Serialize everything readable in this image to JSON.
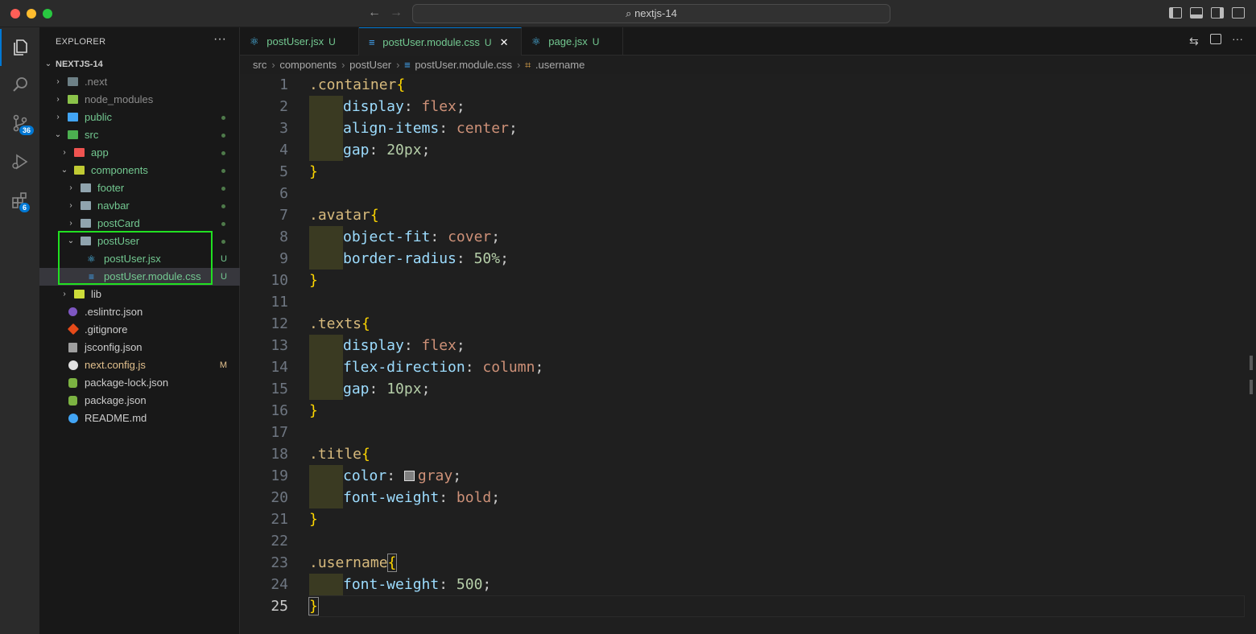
{
  "window": {
    "command_center": "nextjs-14"
  },
  "activity_bar": {
    "source_control_badge": "36",
    "extensions_badge": "6"
  },
  "sidebar": {
    "title": "EXPLORER",
    "more": "···",
    "root": "NEXTJS-14",
    "items": [
      {
        "label": ".next",
        "status": ""
      },
      {
        "label": "node_modules",
        "status": ""
      },
      {
        "label": "public",
        "status": "•"
      },
      {
        "label": "src",
        "status": "•"
      },
      {
        "label": "app",
        "status": "•"
      },
      {
        "label": "components",
        "status": "•"
      },
      {
        "label": "footer",
        "status": "•"
      },
      {
        "label": "navbar",
        "status": "•"
      },
      {
        "label": "postCard",
        "status": "•"
      },
      {
        "label": "postUser",
        "status": "•"
      },
      {
        "label": "postUser.jsx",
        "status": "U"
      },
      {
        "label": "postUser.module.css",
        "status": "U"
      },
      {
        "label": "lib",
        "status": ""
      },
      {
        "label": ".eslintrc.json",
        "status": ""
      },
      {
        "label": ".gitignore",
        "status": ""
      },
      {
        "label": "jsconfig.json",
        "status": ""
      },
      {
        "label": "next.config.js",
        "status": "M"
      },
      {
        "label": "package-lock.json",
        "status": ""
      },
      {
        "label": "package.json",
        "status": ""
      },
      {
        "label": "README.md",
        "status": ""
      }
    ]
  },
  "tabs": [
    {
      "label": "postUser.jsx",
      "status": "U"
    },
    {
      "label": "postUser.module.css",
      "status": "U",
      "close": "✕"
    },
    {
      "label": "page.jsx",
      "status": "U"
    }
  ],
  "breadcrumb": {
    "parts": [
      "src",
      "components",
      "postUser",
      "postUser.module.css",
      ".username"
    ]
  },
  "editor": {
    "line_numbers": [
      "1",
      "2",
      "3",
      "4",
      "5",
      "6",
      "7",
      "8",
      "9",
      "10",
      "11",
      "12",
      "13",
      "14",
      "15",
      "16",
      "17",
      "18",
      "19",
      "20",
      "21",
      "22",
      "23",
      "24",
      "25"
    ],
    "code": {
      "l1_sel": ".container",
      "l1_b": "{",
      "l2_p": "display",
      "l2_v": "flex",
      "l3_p": "align-items",
      "l3_v": "center",
      "l4_p": "gap",
      "l4_v": "20px",
      "l5_b": "}",
      "l7_sel": ".avatar",
      "l7_b": "{",
      "l8_p": "object-fit",
      "l8_v": "cover",
      "l9_p": "border-radius",
      "l9_v": "50%",
      "l10_b": "}",
      "l12_sel": ".texts",
      "l12_b": "{",
      "l13_p": "display",
      "l13_v": "flex",
      "l14_p": "flex-direction",
      "l14_v": "column",
      "l15_p": "gap",
      "l15_v": "10px",
      "l16_b": "}",
      "l18_sel": ".title",
      "l18_b": "{",
      "l19_p": "color",
      "l19_v": "gray",
      "l20_p": "font-weight",
      "l20_v": "bold",
      "l21_b": "}",
      "l23_sel": ".username",
      "l23_b": "{",
      "l24_p": "font-weight",
      "l24_v": "500",
      "l25_b": "}"
    }
  },
  "colors": {
    "accent": "#0078d4",
    "highlight_box": "#21e021",
    "untracked": "#73c991",
    "modified": "#e2c08d"
  }
}
